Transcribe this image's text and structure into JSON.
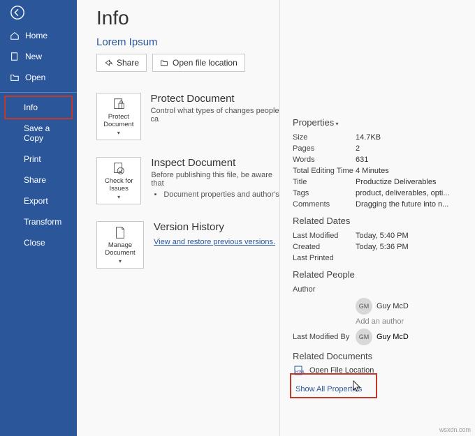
{
  "sidebar": {
    "items": [
      {
        "label": "Home"
      },
      {
        "label": "New"
      },
      {
        "label": "Open"
      },
      {
        "label": "Info"
      },
      {
        "label": "Save a Copy"
      },
      {
        "label": "Print"
      },
      {
        "label": "Share"
      },
      {
        "label": "Export"
      },
      {
        "label": "Transform"
      },
      {
        "label": "Close"
      }
    ]
  },
  "header": {
    "title": "Info",
    "docname": "Lorem Ipsum",
    "share": "Share",
    "openloc": "Open file location"
  },
  "tiles": {
    "protect": {
      "caption": "Protect Document",
      "title": "Protect Document",
      "desc": "Control what types of changes people ca"
    },
    "inspect": {
      "caption": "Check for Issues",
      "title": "Inspect Document",
      "desc": "Before publishing this file, be aware that",
      "bullet": "Document properties and author's"
    },
    "version": {
      "caption": "Manage Document",
      "title": "Version History",
      "link": "View and restore previous versions."
    }
  },
  "props": {
    "head": "Properties",
    "rows": [
      {
        "k": "Size",
        "v": "14.7KB"
      },
      {
        "k": "Pages",
        "v": "2"
      },
      {
        "k": "Words",
        "v": "631"
      },
      {
        "k": "Total Editing Time",
        "v": "4 Minutes"
      },
      {
        "k": "Title",
        "v": "Productize Deliverables"
      },
      {
        "k": "Tags",
        "v": "product, deliverables, opti..."
      },
      {
        "k": "Comments",
        "v": "Dragging the future into n..."
      }
    ]
  },
  "dates": {
    "head": "Related Dates",
    "rows": [
      {
        "k": "Last Modified",
        "v": "Today, 5:40 PM"
      },
      {
        "k": "Created",
        "v": "Today, 5:36 PM"
      },
      {
        "k": "Last Printed",
        "v": ""
      }
    ]
  },
  "people": {
    "head": "Related People",
    "author_k": "Author",
    "author_initials": "GM",
    "author_name": "Guy McD",
    "add": "Add an author",
    "lmby_k": "Last Modified By",
    "lmby_initials": "GM",
    "lmby_name": "Guy McD"
  },
  "docs": {
    "head": "Related Documents",
    "openloc": "Open File Location",
    "showall": "Show All Properties"
  },
  "watermark": "wsxdn.com"
}
